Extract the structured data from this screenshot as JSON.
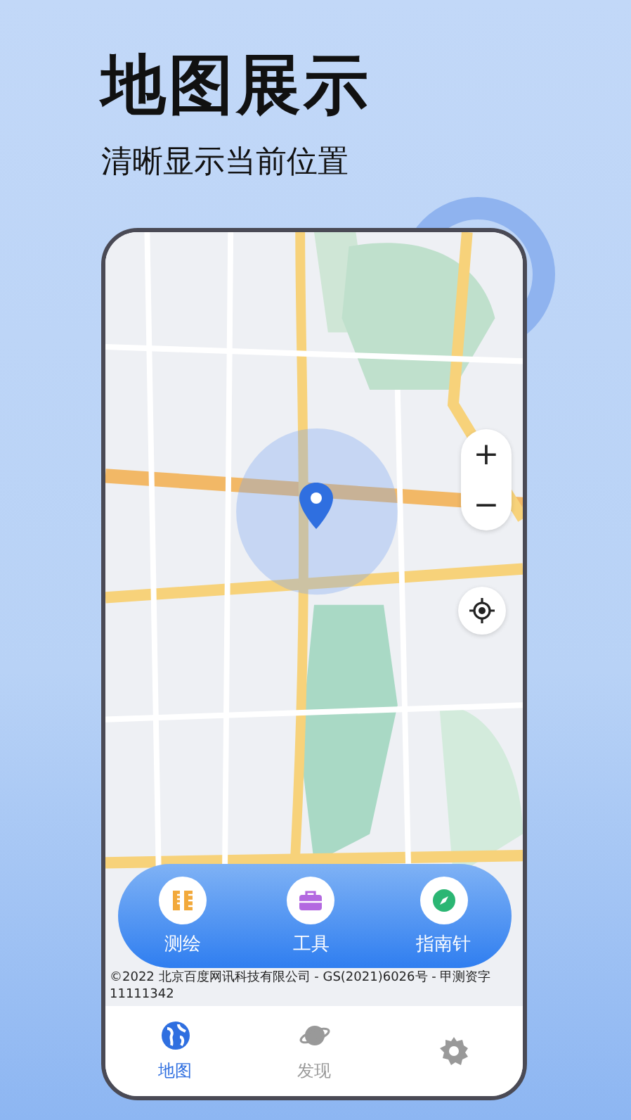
{
  "headline": "地图展示",
  "subtitle": "清晰显示当前位置",
  "map": {
    "zoom_in": "+",
    "zoom_out": "−",
    "copyright": "©2022 北京百度网讯科技有限公司 - GS(2021)6026号 - 甲测资字11111342"
  },
  "actions": [
    {
      "kind": "survey",
      "label": "测绘"
    },
    {
      "kind": "tools",
      "label": "工具"
    },
    {
      "kind": "compass",
      "label": "指南针"
    }
  ],
  "tabs": [
    {
      "kind": "globe",
      "label": "地图",
      "selected": true
    },
    {
      "kind": "planet",
      "label": "发现",
      "selected": false
    },
    {
      "kind": "gear",
      "selected": false
    }
  ]
}
